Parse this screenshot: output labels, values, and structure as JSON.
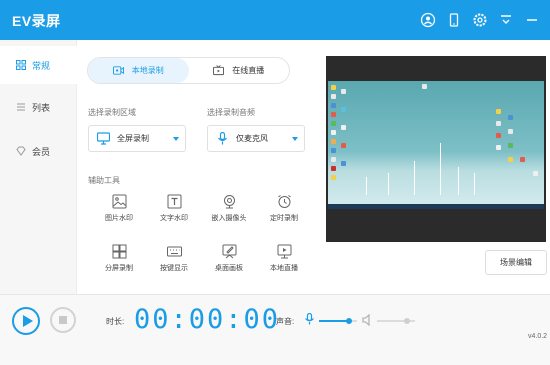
{
  "app": {
    "title": "EV录屏"
  },
  "titlebar_icons": [
    "user-icon",
    "mobile-icon",
    "settings-icon",
    "menu-icon",
    "minimize-icon"
  ],
  "sidebar": {
    "items": [
      {
        "label": "常规",
        "icon": "grid-icon",
        "active": true
      },
      {
        "label": "列表",
        "icon": "list-icon",
        "active": false
      },
      {
        "label": "会员",
        "icon": "diamond-icon",
        "active": false
      }
    ]
  },
  "tabs": [
    {
      "label": "本地录制",
      "icon": "record-icon",
      "active": true
    },
    {
      "label": "在线直播",
      "icon": "tv-icon",
      "active": false
    }
  ],
  "region": {
    "label": "选择录制区域",
    "value": "全屏录制"
  },
  "audio": {
    "label": "选择录制音频",
    "value": "仅麦克风"
  },
  "tools": {
    "label": "辅助工具",
    "items": [
      {
        "label": "图片水印",
        "icon": "image-icon"
      },
      {
        "label": "文字水印",
        "icon": "text-icon"
      },
      {
        "label": "嵌入摄像头",
        "icon": "camera-icon"
      },
      {
        "label": "定时录制",
        "icon": "alarm-icon"
      },
      {
        "label": "分屏录制",
        "icon": "split-screen-icon"
      },
      {
        "label": "按键显示",
        "icon": "keyboard-icon"
      },
      {
        "label": "桌面画板",
        "icon": "pen-icon"
      },
      {
        "label": "本地直播",
        "icon": "play-screen-icon"
      }
    ]
  },
  "scene_button": "场景编辑",
  "bottom": {
    "duration_label": "时长:",
    "timer": "00:00:00",
    "sound_label": "声音:",
    "mic_volume": 0.8,
    "speaker_volume": 0.8,
    "version": "v4.0.2"
  },
  "colors": {
    "accent": "#1a9ce6",
    "titlebar": "#1a9ce6"
  }
}
